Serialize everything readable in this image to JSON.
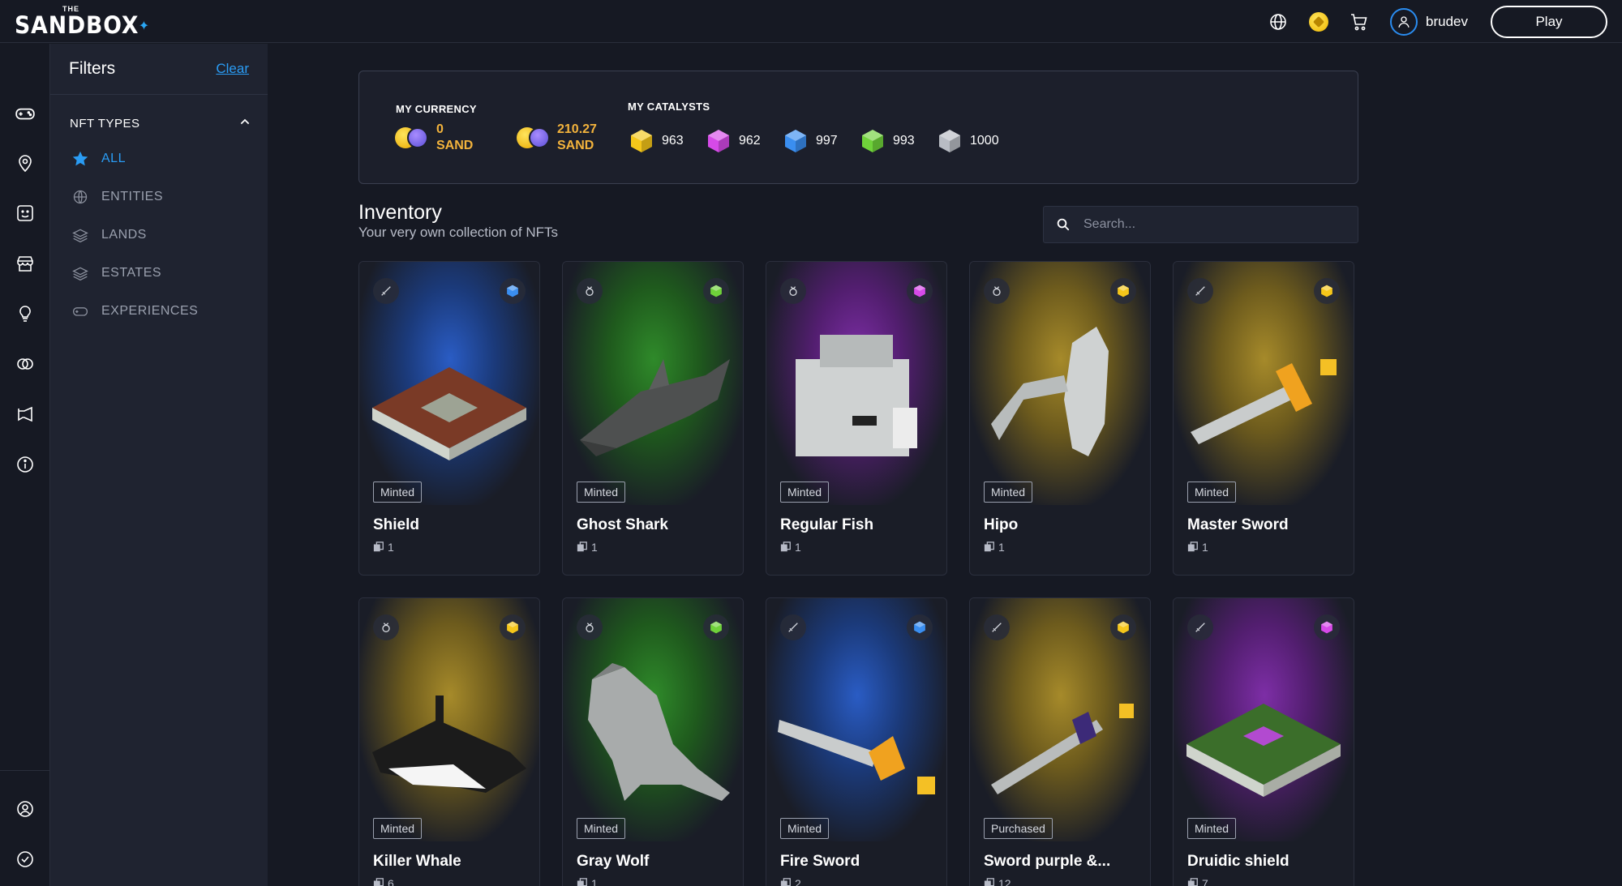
{
  "brand": {
    "the": "THE",
    "word": "SANDBOX"
  },
  "header": {
    "username": "brudev",
    "play_label": "Play"
  },
  "filters": {
    "title": "Filters",
    "clear_label": "Clear",
    "section_label": "NFT TYPES",
    "types": [
      {
        "label": "ALL",
        "icon": "star-icon",
        "active": true
      },
      {
        "label": "ENTITIES",
        "icon": "entity-icon",
        "active": false
      },
      {
        "label": "LANDS",
        "icon": "land-icon",
        "active": false
      },
      {
        "label": "ESTATES",
        "icon": "estate-icon",
        "active": false
      },
      {
        "label": "EXPERIENCES",
        "icon": "gamepad-icon",
        "active": false
      }
    ]
  },
  "currency": {
    "my_currency_label": "MY CURRENCY",
    "balances": [
      {
        "amount": "0",
        "unit": "SAND"
      },
      {
        "amount": "210.27",
        "unit": "SAND"
      }
    ],
    "my_catalysts_label": "MY CATALYSTS",
    "catalysts": [
      {
        "color": "#f5c61a",
        "count": "963"
      },
      {
        "color": "#d64ae8",
        "count": "962"
      },
      {
        "color": "#3a8ef0",
        "count": "997"
      },
      {
        "color": "#6fd23a",
        "count": "993"
      },
      {
        "color": "#b8bcc4",
        "count": "1000"
      }
    ]
  },
  "inventory": {
    "title": "Inventory",
    "subtitle": "Your very own collection of NFTs",
    "search_placeholder": "Search...",
    "items": [
      {
        "name": "Shield",
        "status": "Minted",
        "qty": "1",
        "glow": "blue",
        "type_icon": "sword-icon",
        "catalyst_color": "#3a8ef0"
      },
      {
        "name": "Ghost Shark",
        "status": "Minted",
        "qty": "1",
        "glow": "green",
        "type_icon": "ring-icon",
        "catalyst_color": "#6fd23a"
      },
      {
        "name": "Regular Fish",
        "status": "Minted",
        "qty": "1",
        "glow": "purple",
        "type_icon": "ring-icon",
        "catalyst_color": "#d64ae8"
      },
      {
        "name": "Hipo",
        "status": "Minted",
        "qty": "1",
        "glow": "yellow",
        "type_icon": "ring-icon",
        "catalyst_color": "#f5c61a"
      },
      {
        "name": "Master Sword",
        "status": "Minted",
        "qty": "1",
        "glow": "yellow",
        "type_icon": "sword-icon",
        "catalyst_color": "#f5c61a"
      },
      {
        "name": "Killer Whale",
        "status": "Minted",
        "qty": "6",
        "glow": "yellow",
        "type_icon": "ring-icon",
        "catalyst_color": "#f5c61a"
      },
      {
        "name": "Gray Wolf",
        "status": "Minted",
        "qty": "1",
        "glow": "green",
        "type_icon": "ring-icon",
        "catalyst_color": "#6fd23a"
      },
      {
        "name": "Fire Sword",
        "status": "Minted",
        "qty": "2",
        "glow": "blue",
        "type_icon": "sword-icon",
        "catalyst_color": "#3a8ef0"
      },
      {
        "name": "Sword purple &...",
        "status": "Purchased",
        "qty": "12",
        "glow": "yellow",
        "type_icon": "sword-icon",
        "catalyst_color": "#f5c61a"
      },
      {
        "name": "Druidic shield",
        "status": "Minted",
        "qty": "7",
        "glow": "purple",
        "type_icon": "sword-icon",
        "catalyst_color": "#d64ae8"
      }
    ]
  }
}
